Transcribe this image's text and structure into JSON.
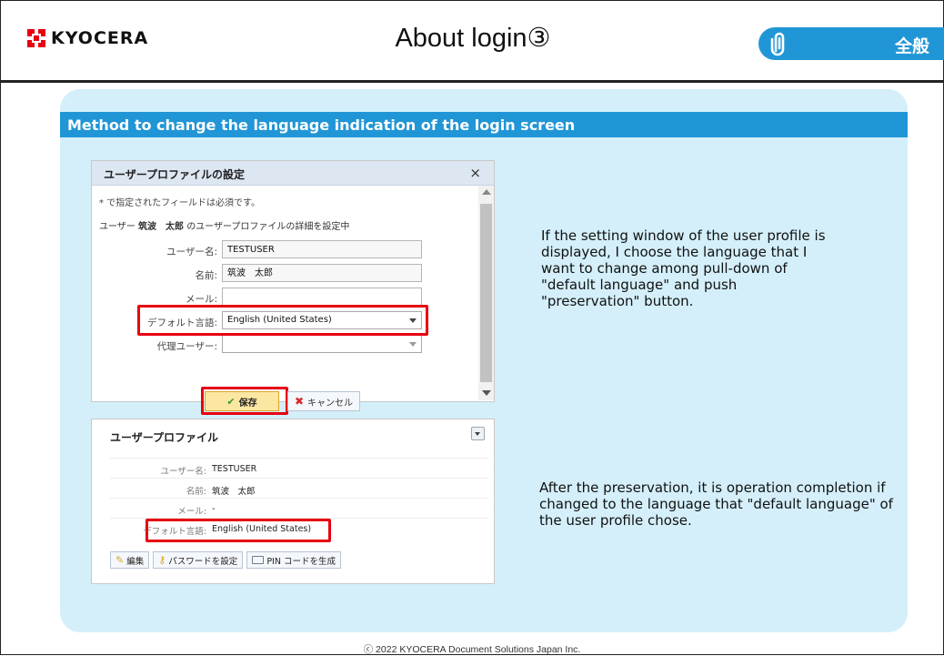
{
  "brand": {
    "logo_text": "KYOCERA"
  },
  "slide": {
    "title": "About login③",
    "tag_label": "全般",
    "section_title": "Method to change the language indication of the login screen"
  },
  "dialog": {
    "title": "ユーザープロファイルの設定",
    "close": "×",
    "note": "* で指定されたフィールドは必須です。",
    "editing_prefix": "ユーザー",
    "editing_user": "筑波　太郎",
    "editing_suffix": "のユーザープロファイルの詳細を設定中",
    "fields": {
      "username_label": "ユーザー名:",
      "username_value": "TESTUSER",
      "name_label": "名前:",
      "name_value": "筑波　太郎",
      "mail_label": "メール:",
      "mail_value": "",
      "lang_label": "デフォルト言語:",
      "lang_value": "English (United States)",
      "proxy_label": "代理ユーザー:",
      "proxy_value": ""
    },
    "save_label": "保存",
    "cancel_label": "キャンセル"
  },
  "profile": {
    "title": "ユーザープロファイル",
    "rows": [
      {
        "label": "ユーザー名:",
        "value": "TESTUSER"
      },
      {
        "label": "名前:",
        "value": "筑波　太郎"
      },
      {
        "label": "メール:",
        "value": "-"
      },
      {
        "label": "デフォルト言語:",
        "value": "English (United States)"
      }
    ],
    "buttons": {
      "edit": "編集",
      "password": "パスワードを設定",
      "pin": "PIN コードを生成"
    }
  },
  "descriptions": {
    "step1": "If the setting window of the user profile is displayed, I choose the language that I want to change among pull-down of \"default language\" and push \"preservation\" button.",
    "step2": "After the preservation, it is operation completion if changed to the language that \"default language\" of the user profile chose."
  },
  "footer": "ⓒ 2022 KYOCERA Document Solutions Japan Inc.",
  "colors": {
    "accent_blue": "#2196d6",
    "panel_bg": "#d4effa",
    "highlight_red": "#e60012"
  }
}
